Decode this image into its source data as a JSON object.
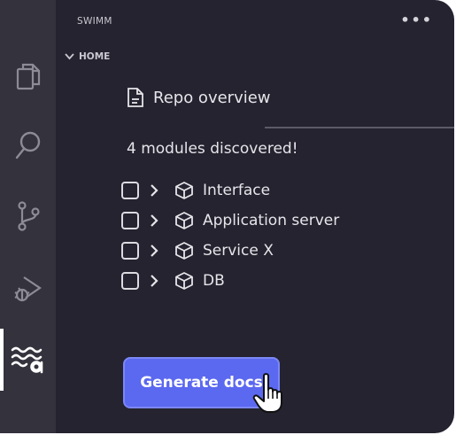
{
  "header": {
    "title": "SWIMM",
    "more_icon": "ellipsis-icon"
  },
  "section": {
    "label": "HOME"
  },
  "repo": {
    "title": "Repo overview",
    "icon": "document-icon"
  },
  "discovery": {
    "message": "4 modules discovered!"
  },
  "modules": [
    {
      "label": "Interface",
      "checked": false
    },
    {
      "label": "Application server",
      "checked": false
    },
    {
      "label": "Service X",
      "checked": false
    },
    {
      "label": "DB",
      "checked": false
    }
  ],
  "actions": {
    "generate_label": "Generate docs"
  },
  "activity_bar": {
    "icons": [
      "files-icon",
      "search-icon",
      "source-control-icon",
      "run-debug-icon",
      "swimm-icon"
    ],
    "active": "swimm-icon"
  },
  "colors": {
    "background": "#24232f",
    "activity_bar": "#33323d",
    "accent": "#5b68f0",
    "text": "#e6e5ea"
  }
}
